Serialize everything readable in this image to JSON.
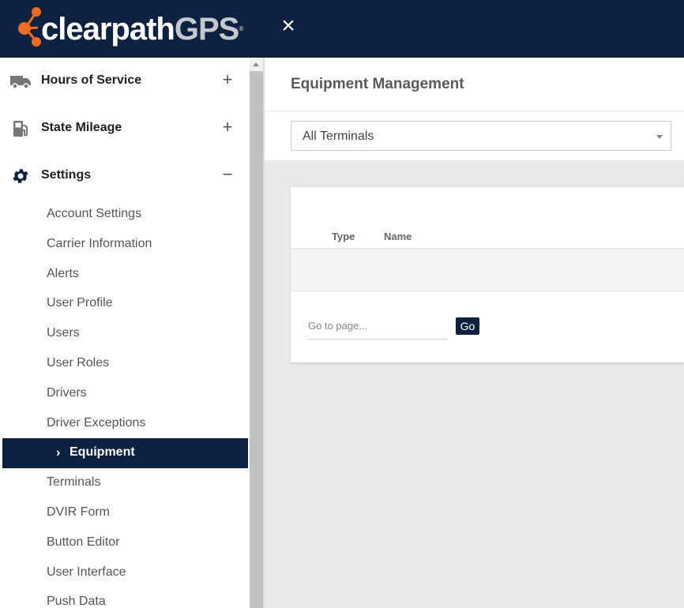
{
  "brand": {
    "name_part1": "clearpath",
    "name_part2": "GPS",
    "trademark": "®",
    "accent_color": "#f26b21",
    "navy_color": "#0d2140"
  },
  "topbar": {
    "close_icon": "×"
  },
  "sidebar": {
    "sections": [
      {
        "icon": "truck-icon",
        "label": "Hours of Service",
        "toggle": "+"
      },
      {
        "icon": "fuel-pump-icon",
        "label": "State Mileage",
        "toggle": "+"
      },
      {
        "icon": "gear-icon",
        "label": "Settings",
        "toggle": "−"
      }
    ],
    "settings_items": [
      "Account Settings",
      "Carrier Information",
      "Alerts",
      "User Profile",
      "Users",
      "User Roles",
      "Drivers",
      "Driver Exceptions",
      "Equipment",
      "Terminals",
      "DVIR Form",
      "Button Editor",
      "User Interface",
      "Push Data"
    ],
    "active_item": "Equipment",
    "active_chevron": "›"
  },
  "main": {
    "title": "Equipment Management",
    "filter": {
      "selected": "All Terminals"
    },
    "table": {
      "columns": [
        "Type",
        "Name"
      ]
    },
    "pagination": {
      "placeholder": "Go to page...",
      "go_label": "Go"
    }
  }
}
